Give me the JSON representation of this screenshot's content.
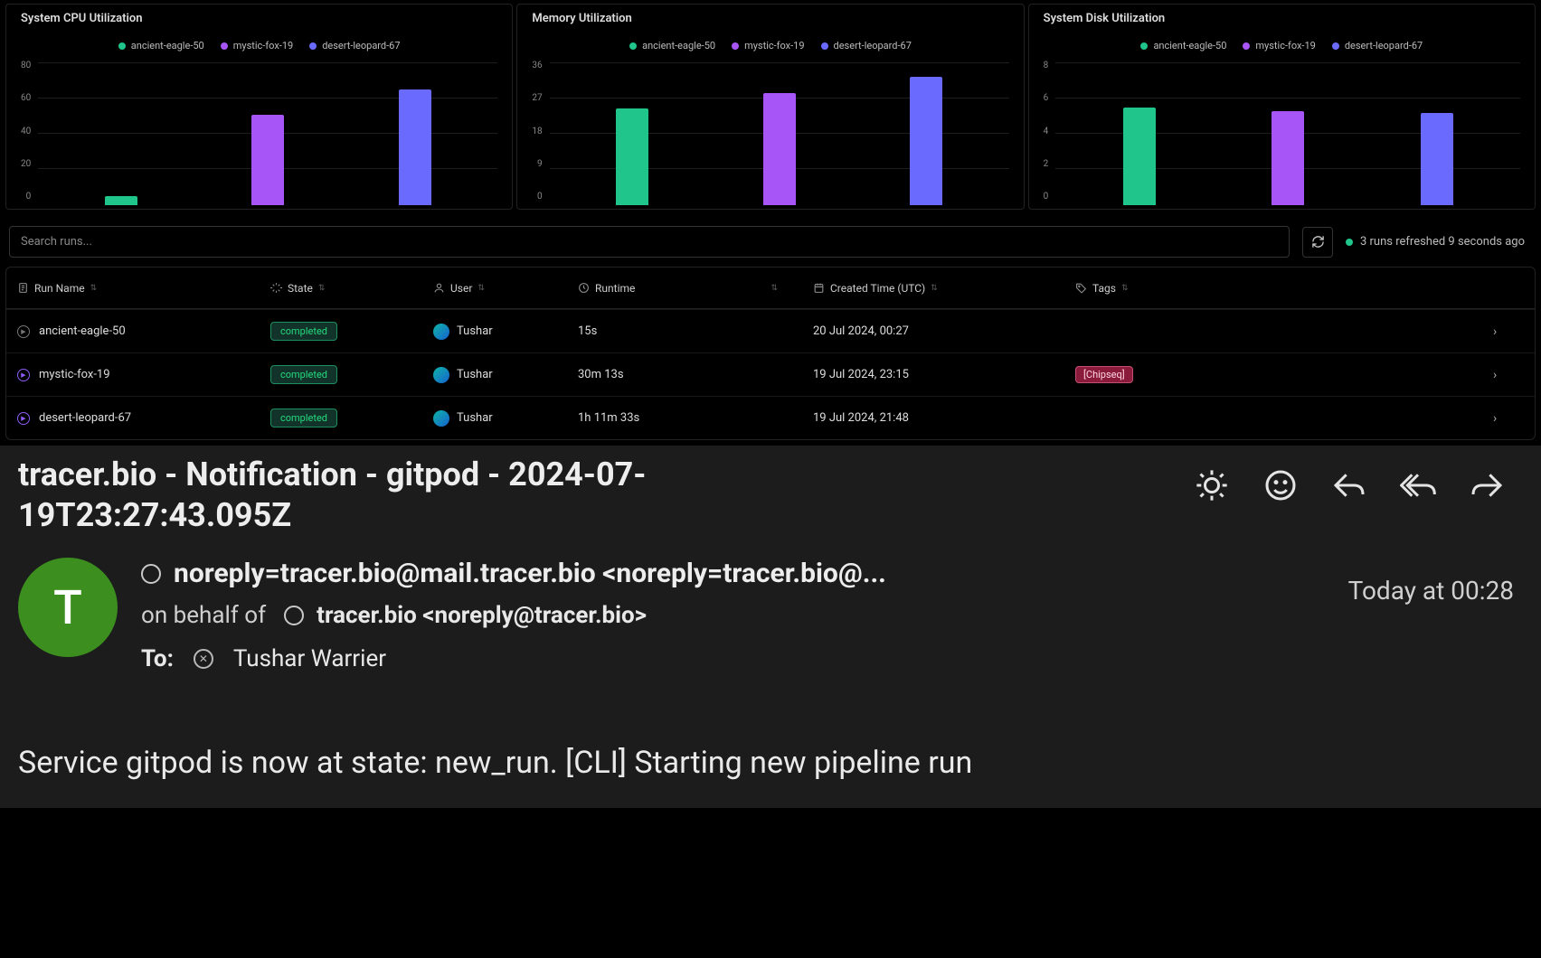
{
  "colors": {
    "green": "#1fc58b",
    "purple": "#a855f7",
    "indigo": "#6a6aff"
  },
  "chart_data": [
    {
      "type": "bar",
      "title": "System CPU Utilization",
      "ylim": [
        0,
        80
      ],
      "yticks": [
        0,
        20,
        40,
        60,
        80
      ],
      "categories": [
        "ancient-eagle-50",
        "mystic-fox-19",
        "desert-leopard-67"
      ],
      "series": [
        {
          "name": "ancient-eagle-50",
          "color": "#1fc58b",
          "value": 5
        },
        {
          "name": "mystic-fox-19",
          "color": "#a855f7",
          "value": 50
        },
        {
          "name": "desert-leopard-67",
          "color": "#6a6aff",
          "value": 64
        }
      ]
    },
    {
      "type": "bar",
      "title": "Memory Utilization",
      "ylim": [
        0,
        36
      ],
      "yticks": [
        0,
        9,
        18,
        27,
        36
      ],
      "categories": [
        "ancient-eagle-50",
        "mystic-fox-19",
        "desert-leopard-67"
      ],
      "series": [
        {
          "name": "ancient-eagle-50",
          "color": "#1fc58b",
          "value": 24
        },
        {
          "name": "mystic-fox-19",
          "color": "#a855f7",
          "value": 28
        },
        {
          "name": "desert-leopard-67",
          "color": "#6a6aff",
          "value": 32
        }
      ]
    },
    {
      "type": "bar",
      "title": "System Disk Utilization",
      "ylim": [
        0,
        8
      ],
      "yticks": [
        0,
        2,
        4,
        6,
        8
      ],
      "categories": [
        "ancient-eagle-50",
        "mystic-fox-19",
        "desert-leopard-67"
      ],
      "series": [
        {
          "name": "ancient-eagle-50",
          "color": "#1fc58b",
          "value": 5.4
        },
        {
          "name": "mystic-fox-19",
          "color": "#a855f7",
          "value": 5.2
        },
        {
          "name": "desert-leopard-67",
          "color": "#6a6aff",
          "value": 5.1
        }
      ]
    }
  ],
  "search": {
    "placeholder": "Search runs..."
  },
  "status_text": "3 runs refreshed 9 seconds ago",
  "table": {
    "headers": {
      "run": "Run Name",
      "state": "State",
      "user": "User",
      "runtime": "Runtime",
      "created": "Created Time (UTC)",
      "tags": "Tags"
    },
    "rows": [
      {
        "icon": "gray",
        "name": "ancient-eagle-50",
        "state": "completed",
        "user": "Tushar",
        "runtime": "15s",
        "created": "20 Jul 2024, 00:27",
        "tag": ""
      },
      {
        "icon": "purple",
        "name": "mystic-fox-19",
        "state": "completed",
        "user": "Tushar",
        "runtime": "30m 13s",
        "created": "19 Jul 2024, 23:15",
        "tag": "Chipseq"
      },
      {
        "icon": "purple",
        "name": "desert-leopard-67",
        "state": "completed",
        "user": "Tushar",
        "runtime": "1h 11m 33s",
        "created": "19 Jul 2024, 21:48",
        "tag": ""
      }
    ]
  },
  "email": {
    "subject": "tracer.bio - Notification - gitpod - 2024-07-19T23:27:43.095Z",
    "avatar_initial": "T",
    "from": "noreply=tracer.bio@mail.tracer.bio <noreply=tracer.bio@...",
    "on_behalf_label": "on behalf of",
    "on_behalf": "tracer.bio <noreply@tracer.bio>",
    "to_label": "To:",
    "to": "Tushar Warrier",
    "timestamp": "Today at 00:28",
    "body": "Service gitpod is now at state: new_run. [CLI] Starting new pipeline run"
  }
}
